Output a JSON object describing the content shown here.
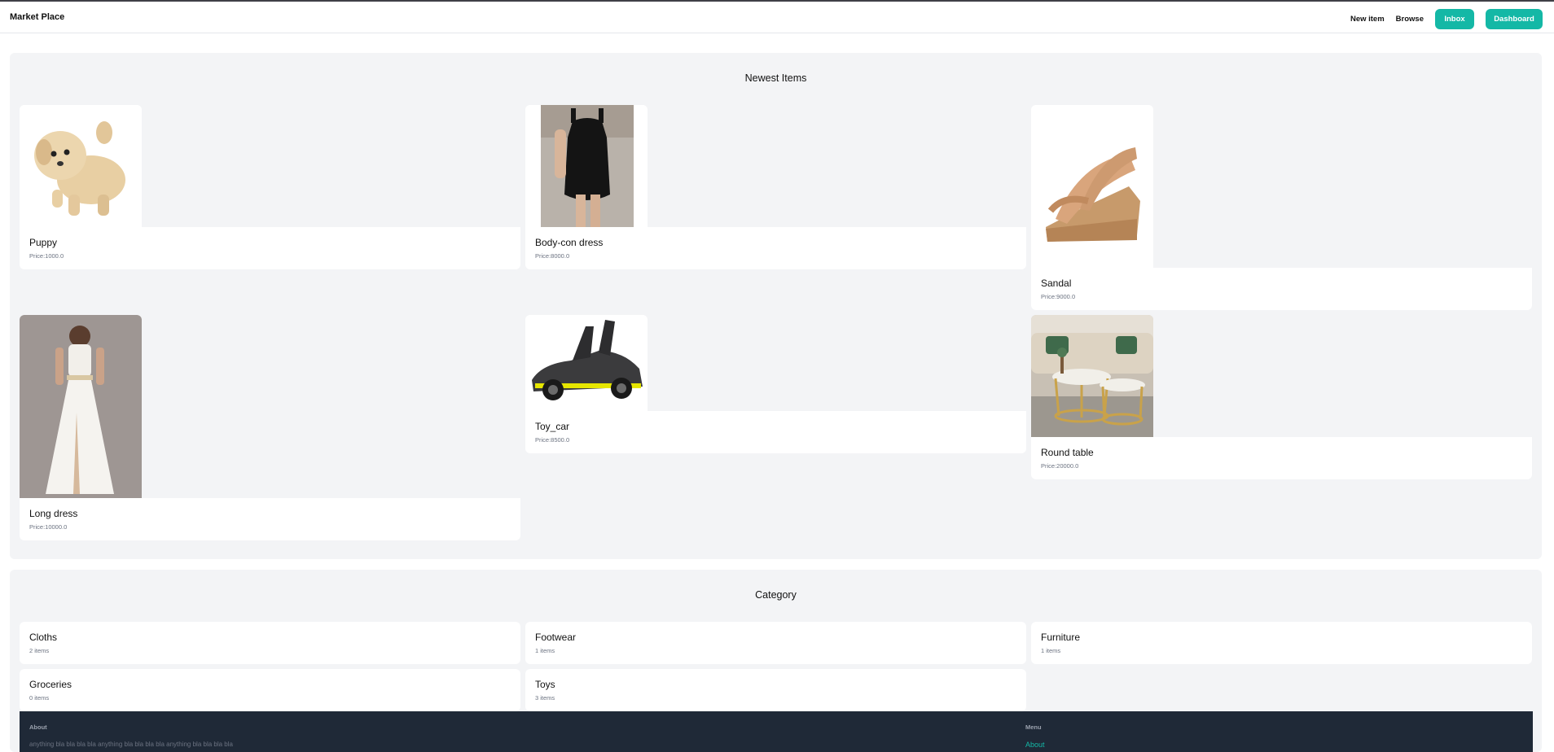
{
  "header": {
    "brand": "Market Place",
    "nav": {
      "new_item": "New item",
      "browse": "Browse",
      "inbox": "Inbox",
      "dashboard": "Dashboard"
    }
  },
  "newest": {
    "title": "Newest Items",
    "items": [
      {
        "name": "Puppy",
        "price": "Price:1000.0",
        "image": "puppy-plush-image"
      },
      {
        "name": "Body-con dress",
        "price": "Price:8000.0",
        "image": "black-dress-image"
      },
      {
        "name": "Sandal",
        "price": "Price:9000.0",
        "image": "sandal-image"
      },
      {
        "name": "Long dress",
        "price": "Price:10000.0",
        "image": "white-gown-image"
      },
      {
        "name": "Toy_car",
        "price": "Price:8500.0",
        "image": "toy-car-image"
      },
      {
        "name": "Round table",
        "price": "Price:20000.0",
        "image": "round-table-image"
      }
    ]
  },
  "category": {
    "title": "Category",
    "items": [
      {
        "name": "Cloths",
        "count": "2 items"
      },
      {
        "name": "Footwear",
        "count": "1 items"
      },
      {
        "name": "Furniture",
        "count": "1 items"
      },
      {
        "name": "Groceries",
        "count": "0 items"
      },
      {
        "name": "Toys",
        "count": "3 items"
      }
    ]
  },
  "footer": {
    "about_heading": "About",
    "about_text": "anything bla bla bla bla anything bla bla bla bla anything bla bla bla bla",
    "menu_heading": "Menu",
    "menu_about": "About"
  },
  "colors": {
    "accent": "#14b8a6",
    "footer_bg": "#1f2937",
    "section_bg": "#f3f4f6"
  }
}
